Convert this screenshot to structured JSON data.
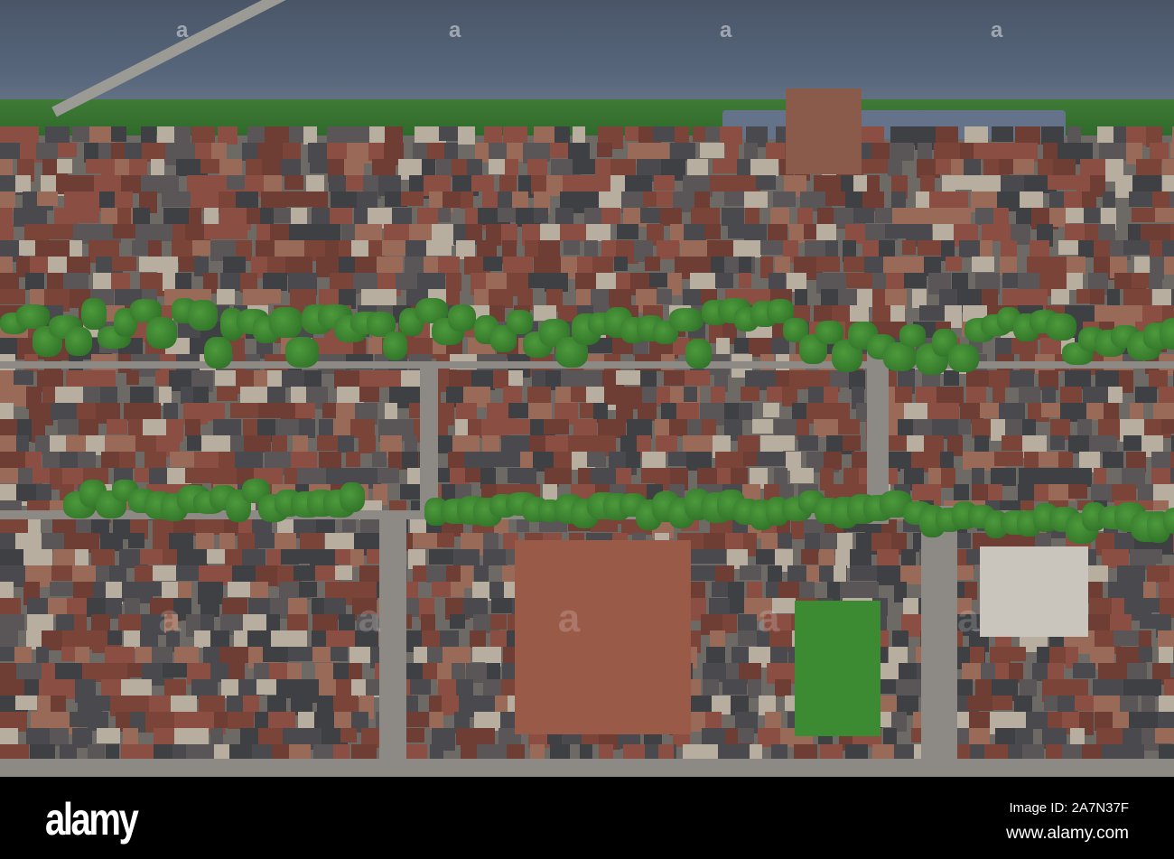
{
  "photo": {
    "subject": "Aerial city view",
    "watermark_text": "alamy"
  },
  "footer": {
    "logo": "alamy",
    "image_id": "Image ID: 2A7N37F",
    "website": "www.alamy.com"
  },
  "colors": {
    "water": "#56657a",
    "brick": "#8a4f42",
    "roof_gray": "#4a4a4e",
    "trees": "#3c8a32",
    "bar": "#000000"
  }
}
